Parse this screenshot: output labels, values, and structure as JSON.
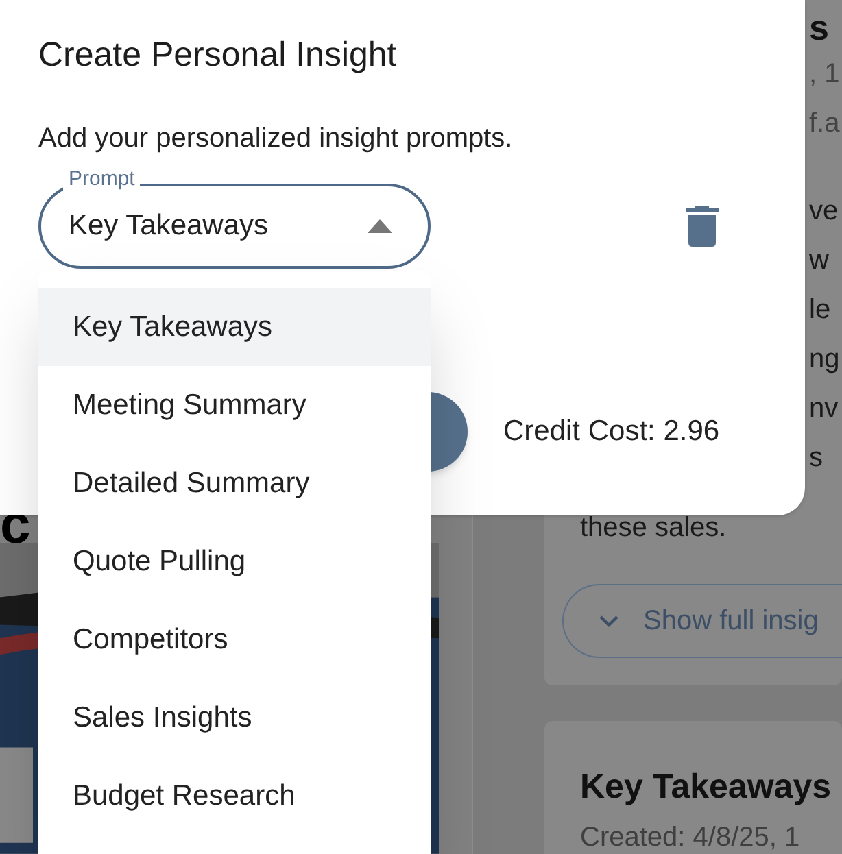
{
  "background": {
    "left_heading": "c",
    "right_card": {
      "title_fragment": "s",
      "line_fragments": [
        ", 1",
        "f.a",
        "ve",
        "w",
        "le",
        "ng",
        "nv",
        "s"
      ],
      "last_line": "these sales.",
      "show_button": "Show full insig"
    },
    "second_card": {
      "title": "Key Takeaways",
      "created": "Created: 4/8/25, 1"
    }
  },
  "dialog": {
    "title": "Create Personal Insight",
    "subtitle": "Add your personalized insight prompts.",
    "prompt_field": {
      "label": "Prompt",
      "value": "Key Takeaways",
      "expanded": true
    },
    "credit_cost": "Credit Cost: 2.96",
    "options": [
      {
        "label": "Key Takeaways",
        "selected": true
      },
      {
        "label": "Meeting Summary",
        "selected": false
      },
      {
        "label": "Detailed Summary",
        "selected": false
      },
      {
        "label": "Quote Pulling",
        "selected": false
      },
      {
        "label": "Competitors",
        "selected": false
      },
      {
        "label": "Sales Insights",
        "selected": false
      },
      {
        "label": "Budget Research",
        "selected": false
      }
    ]
  }
}
